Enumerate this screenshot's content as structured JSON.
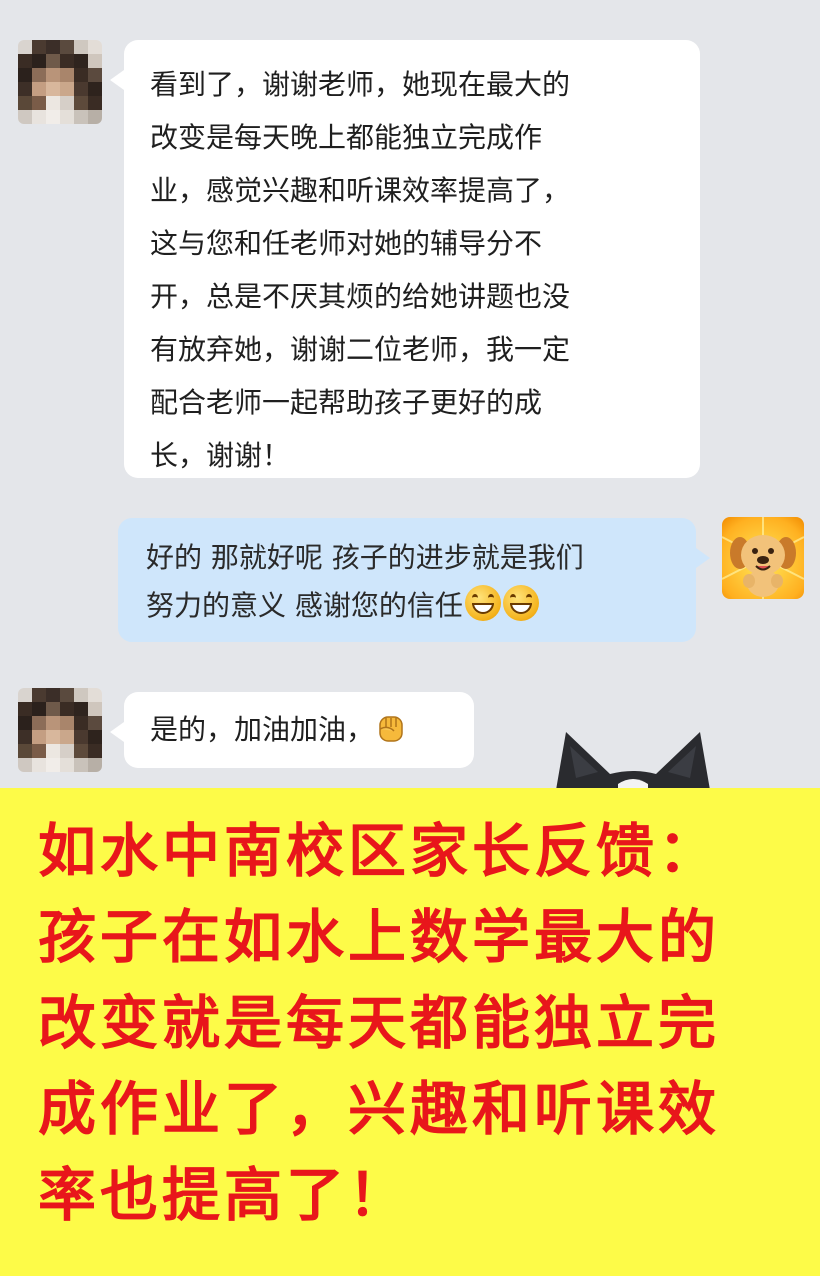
{
  "chat": {
    "messages": [
      {
        "sender": "parent",
        "lines": [
          "看到了，谢谢老师，她现在最大的",
          "改变是每天晚上都能独立完成作",
          "业，感觉兴趣和听课效率提高了，",
          "这与您和任老师对她的辅导分不",
          "开，总是不厌其烦的给她讲题也没",
          "有放弃她，谢谢二位老师，我一定",
          "配合老师一起帮助孩子更好的成",
          "长，谢谢！"
        ]
      },
      {
        "sender": "teacher",
        "lines": [
          "好的 那就好呢 孩子的进步就是我们",
          "努力的意义 感谢您的信任"
        ],
        "trailing_emoji": [
          "grin-emoji",
          "grin-emoji"
        ]
      },
      {
        "sender": "parent",
        "text": "是的，加油加油，",
        "trailing_emoji": [
          "fist-emoji"
        ]
      }
    ]
  },
  "banner": {
    "lines": [
      "如水中南校区家长反馈：",
      "孩子在如水上数学最大的",
      "改变就是每天都能独立完",
      "成作业了，兴趣和听课效",
      "率也提高了！"
    ]
  },
  "colors": {
    "chat_background": "#e4e6ea",
    "incoming_bubble": "#ffffff",
    "outgoing_bubble": "#cfe6fb",
    "banner_background": "#fdfb48",
    "banner_text": "#e8161b"
  }
}
